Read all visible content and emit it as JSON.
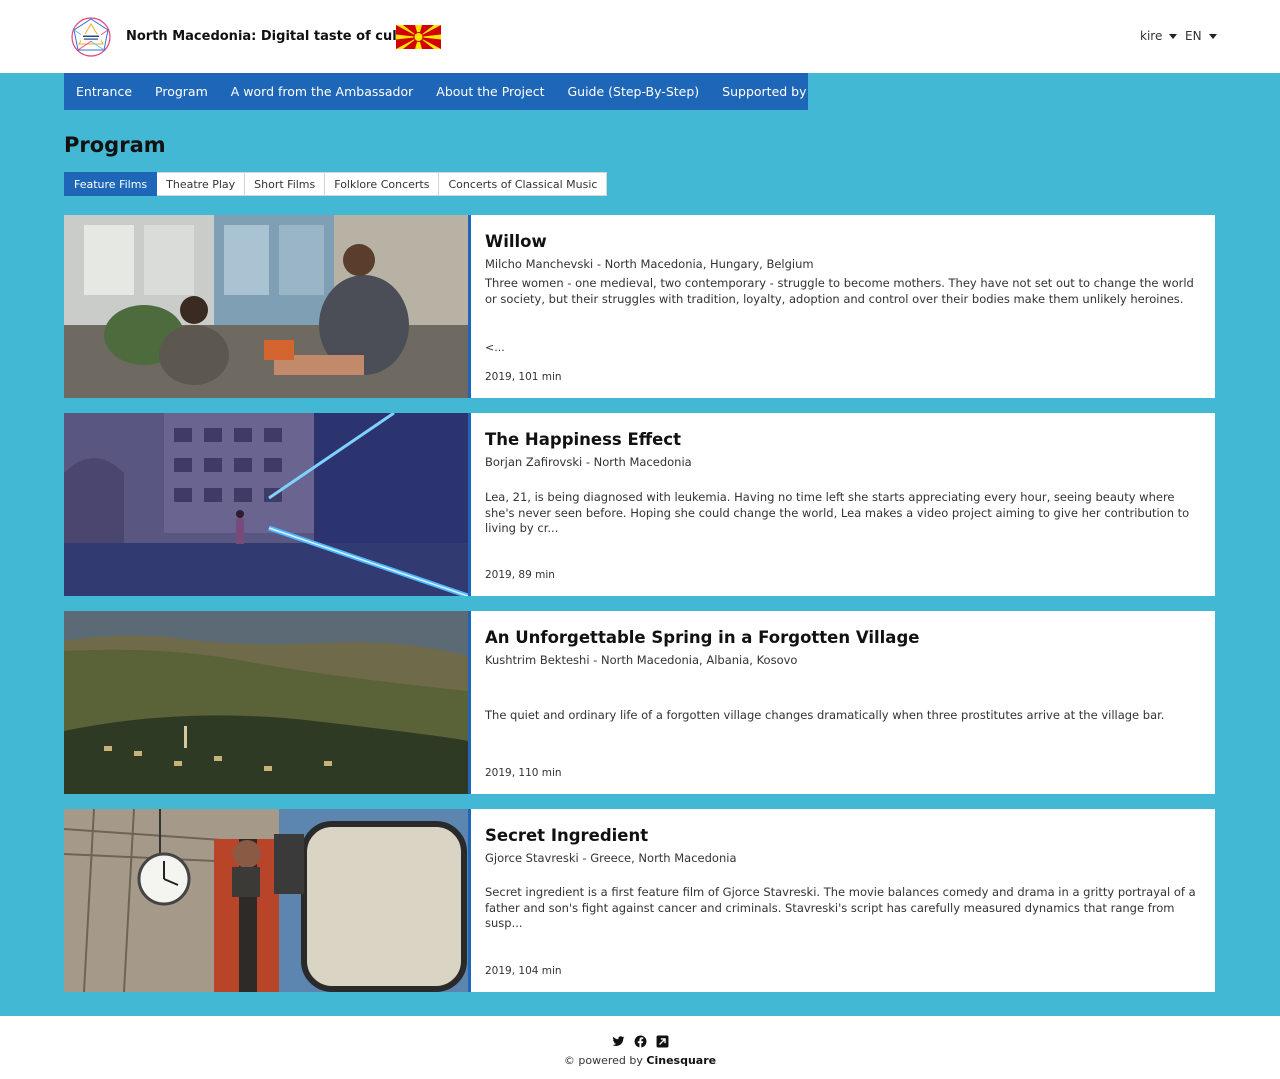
{
  "header": {
    "site_title": "North Macedonia: Digital taste of culture",
    "user": "kire",
    "language": "EN"
  },
  "nav": {
    "items": [
      "Entrance",
      "Program",
      "A word from the Ambassador",
      "About the Project",
      "Guide (Step-By-Step)",
      "Supported by"
    ]
  },
  "page": {
    "title": "Program"
  },
  "tabs": [
    "Feature Films",
    "Theatre Play",
    "Short Films",
    "Folklore Concerts",
    "Concerts of Classical Music"
  ],
  "films": [
    {
      "title": "Willow",
      "director": "Milcho Manchevski - North Macedonia, Hungary, Belgium",
      "description": "Three women - one medieval, two contemporary - struggle to become mothers. They have not set out to change the world or society, but their struggles with tradition, loyalty, adoption and control over their bodies make them unlikely heroines.",
      "more": "<...",
      "meta": "2019, 101 min"
    },
    {
      "title": "The Happiness Effect",
      "director": "Borjan Zafirovski - North Macedonia",
      "description": "Lea, 21, is being diagnosed with leukemia. Having no time left she starts appreciating every hour, seeing beauty where she's never seen before. Hoping she could change the world, Lea makes a video project aiming to give her contribution to living by cr...",
      "meta": "2019, 89 min"
    },
    {
      "title": "An Unforgettable Spring in a Forgotten Village",
      "director": "Kushtrim Bekteshi - North Macedonia, Albania, Kosovo",
      "description": "The quiet and ordinary life of a forgotten village changes dramatically when three prostitutes arrive at the village bar.",
      "meta": "2019, 110 min"
    },
    {
      "title": "Secret Ingredient",
      "director": "Gjorce Stavreski - Greece, North Macedonia",
      "description": "Secret ingredient is a first feature film of Gjorce Stavreski. The movie balances comedy and drama in a gritty portrayal of a father and son's fight against cancer and criminals. Stavreski's script has carefully measured dynamics that range from susp...",
      "meta": "2019, 104 min"
    }
  ],
  "footer": {
    "powered_prefix": "© powered by",
    "brand": "Cinesquare"
  },
  "colors": {
    "accent": "#1e66b8",
    "band": "#42b8d5"
  }
}
